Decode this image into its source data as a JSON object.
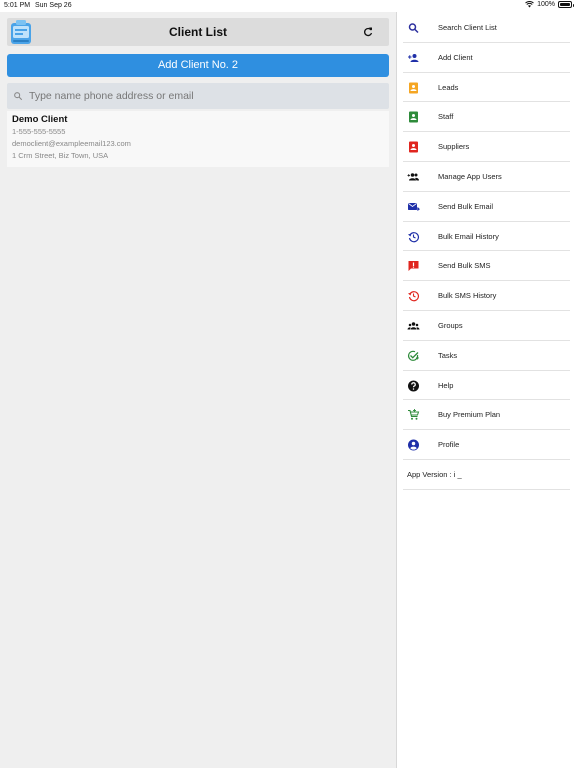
{
  "status_bar": {
    "time": "5:01 PM",
    "date": "Sun Sep 26",
    "battery": "100%"
  },
  "header": {
    "title": "Client List"
  },
  "add_button": {
    "label": "Add Client No. 2"
  },
  "search": {
    "placeholder": "Type name phone address or email",
    "value": ""
  },
  "client": {
    "name": "Demo Client",
    "phone": "1-555-555-5555",
    "email": "democlient@exampleemail123.com",
    "address": "1 Crm Street, Biz Town, USA"
  },
  "menu": {
    "items": [
      {
        "label": "Search Client List",
        "icon": "search-icon",
        "color": "#2c2f9e"
      },
      {
        "label": "Add Client",
        "icon": "add-person-icon",
        "color": "#1f2fa8"
      },
      {
        "label": "Leads",
        "icon": "contact-card-icon",
        "color": "#f5a623"
      },
      {
        "label": "Staff",
        "icon": "contact-card-icon",
        "color": "#2e8b3a"
      },
      {
        "label": "Suppliers",
        "icon": "contact-card-icon",
        "color": "#e0261f"
      },
      {
        "label": "Manage App Users",
        "icon": "group-add-icon",
        "color": "#111111"
      },
      {
        "label": "Send Bulk Email",
        "icon": "mail-send-icon",
        "color": "#1f2fa8"
      },
      {
        "label": "Bulk Email History",
        "icon": "history-icon",
        "color": "#1f2fa8"
      },
      {
        "label": "Send Bulk SMS",
        "icon": "sms-alert-icon",
        "color": "#e0261f"
      },
      {
        "label": "Bulk SMS History",
        "icon": "history-icon",
        "color": "#e0261f"
      },
      {
        "label": "Groups",
        "icon": "groups-icon",
        "color": "#111111"
      },
      {
        "label": "Tasks",
        "icon": "task-check-icon",
        "color": "#2e8b3a"
      },
      {
        "label": "Help",
        "icon": "help-icon",
        "color": "#111111"
      },
      {
        "label": "Buy Premium Plan",
        "icon": "cart-icon",
        "color": "#2e8b3a"
      },
      {
        "label": "Profile",
        "icon": "profile-icon",
        "color": "#1f2fa8"
      }
    ],
    "version": "App Version : i _"
  }
}
